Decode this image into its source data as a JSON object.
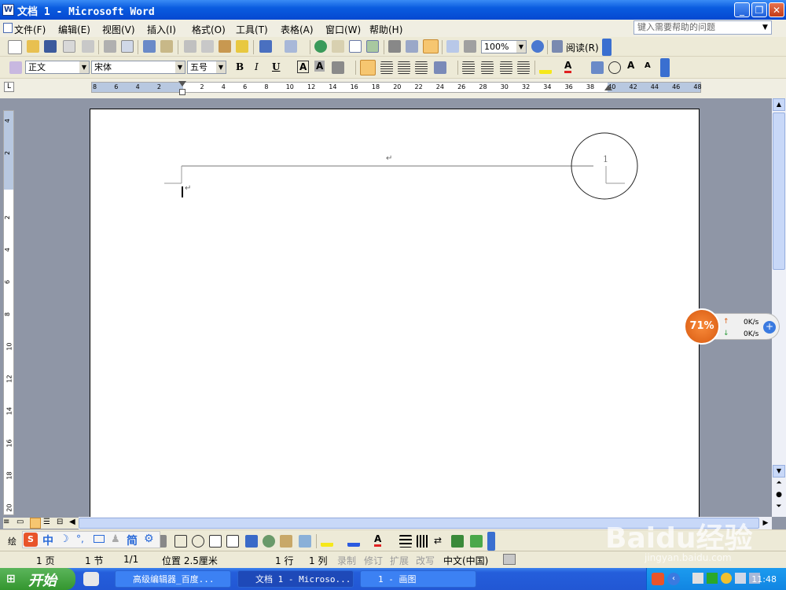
{
  "window": {
    "title": "文档 1 - Microsoft Word",
    "help_placeholder": "键入需要帮助的问题"
  },
  "menu": [
    "文件(F)",
    "编辑(E)",
    "视图(V)",
    "插入(I)",
    "格式(O)",
    "工具(T)",
    "表格(A)",
    "窗口(W)",
    "帮助(H)"
  ],
  "toolbar": {
    "zoom": "100%",
    "read_label": "阅读(R)"
  },
  "format_bar": {
    "style": "正文",
    "font": "宋体",
    "size": "五号",
    "bold": "B",
    "italic": "I",
    "underline": "U",
    "char_border": "A",
    "char_shading": "A"
  },
  "ruler": {
    "h_ticks": [
      "8",
      "6",
      "4",
      "2",
      "",
      "2",
      "4",
      "6",
      "8",
      "10",
      "12",
      "14",
      "16",
      "18",
      "20",
      "22",
      "24",
      "26",
      "28",
      "30",
      "32",
      "34",
      "36",
      "38",
      "40",
      "42",
      "44",
      "46",
      "48"
    ],
    "v_ticks": [
      "4",
      "2",
      "",
      "2",
      "4",
      "6",
      "8",
      "10",
      "12",
      "14",
      "16",
      "18",
      "20"
    ]
  },
  "document": {
    "header_number": "1",
    "para_mark": "↵"
  },
  "net_widget": {
    "percent": "71%",
    "up": "0K/s",
    "down": "0K/s"
  },
  "drawing_bar": {
    "label": "绘",
    "ime": [
      "中",
      "简"
    ]
  },
  "status": {
    "page": "1 页",
    "section": "1 节",
    "page_of": "1/1",
    "position": "位置 2.5厘米",
    "line": "1 行",
    "column": "1 列",
    "rec": "录制",
    "trk": "修订",
    "ext": "扩展",
    "ovr": "改写",
    "lang": "中文(中国)"
  },
  "taskbar": {
    "start": "开始",
    "tasks": [
      "高级编辑器_百度...",
      "文档 1 - Microso...",
      "1 - 画图"
    ],
    "clock": "11:48"
  },
  "watermark": {
    "brand": "Baidu经验",
    "url": "jingyan.baidu.com"
  }
}
